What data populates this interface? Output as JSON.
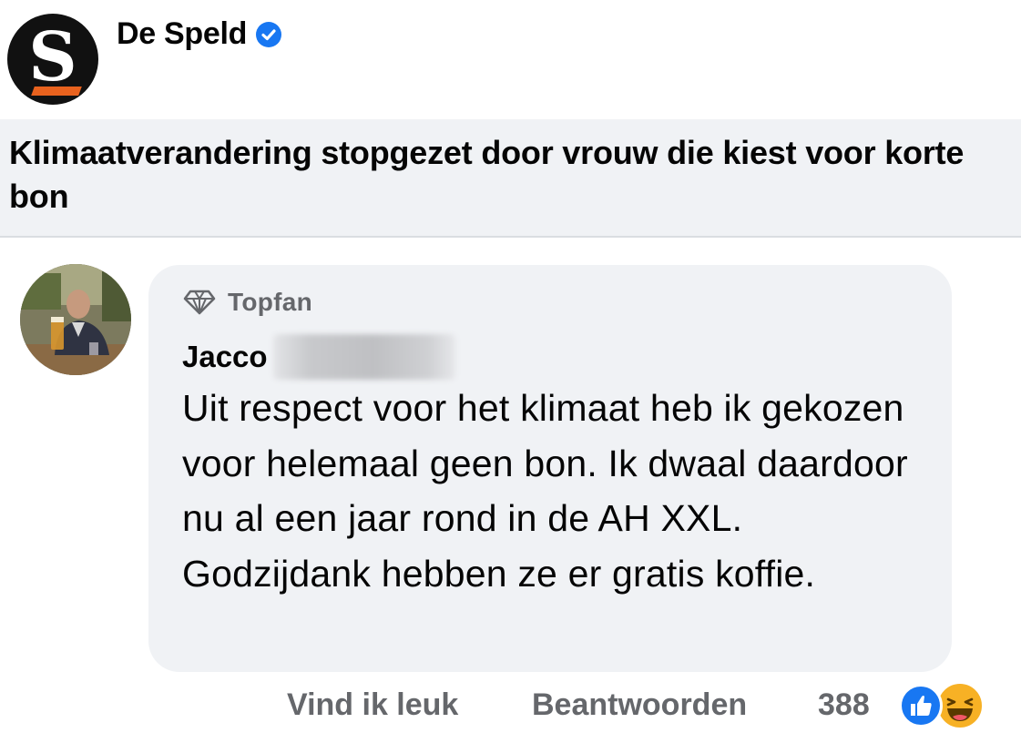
{
  "page": {
    "name": "De Speld",
    "logo_letter": "S",
    "verified_icon": "verified-badge-icon",
    "accent_color": "#1877f2",
    "logo_stripe_color": "#e8621e"
  },
  "post": {
    "headline": "Klimaatverandering stopgezet door vrouw die kiest voor korte bon"
  },
  "comment": {
    "badge_label": "Topfan",
    "badge_icon": "diamond-icon",
    "author": "Jacco",
    "text": "Uit respect voor het klimaat heb ik gekozen voor helemaal geen bon. Ik dwaal daardoor nu al een jaar rond in de AH XXL. Godzijdank hebben ze er gratis koffie.",
    "actions": {
      "like": "Vind ik leuk",
      "reply": "Beantwoorden"
    },
    "reaction_count": "388",
    "reactions": [
      "like-reaction-icon",
      "haha-reaction-icon"
    ]
  }
}
